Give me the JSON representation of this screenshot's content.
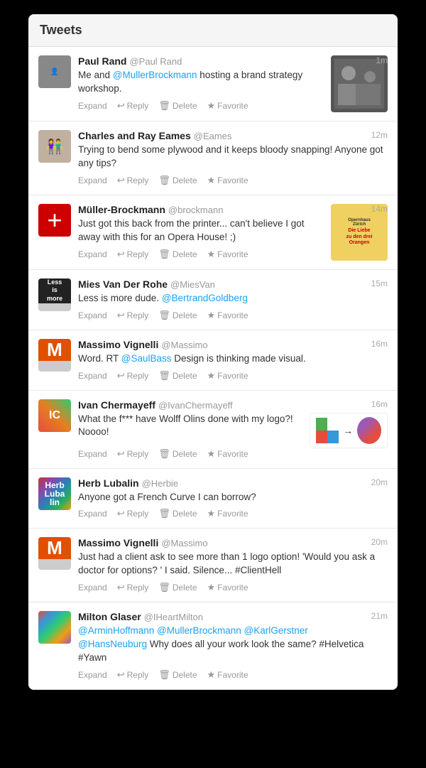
{
  "window": {
    "title": "Tweets"
  },
  "tweets": [
    {
      "id": "tweet-1",
      "name": "Paul Rand",
      "handle": "@Paul Rand",
      "time": "1m",
      "text_parts": [
        {
          "type": "text",
          "content": "Me and "
        },
        {
          "type": "mention",
          "content": "@MullerBrockmann"
        },
        {
          "type": "text",
          "content": " hosting a brand strategy workshop."
        }
      ],
      "text_plain": "Me and @MullerBrockmann hosting a brand strategy workshop.",
      "has_image": true,
      "image_type": "paul-photo",
      "avatar_type": "paul",
      "actions": [
        "Expand",
        "Reply",
        "Delete",
        "Favorite"
      ]
    },
    {
      "id": "tweet-2",
      "name": "Charles and Ray Eames",
      "handle": "@Eames",
      "time": "12m",
      "text_plain": "Trying to bend some plywood and it keeps bloody snapping! Anyone got any tips?",
      "has_image": false,
      "avatar_type": "eames",
      "actions": [
        "Expand",
        "Reply",
        "Delete",
        "Favorite"
      ]
    },
    {
      "id": "tweet-3",
      "name": "Müller-Brockmann",
      "handle": "@brockmann",
      "time": "14m",
      "text_plain": "Just got this back from the printer... can't believe I got away with this for an Opera House! ;)",
      "has_image": true,
      "image_type": "opernhaus",
      "avatar_type": "muller",
      "actions": [
        "Expand",
        "Reply",
        "Delete",
        "Favorite"
      ]
    },
    {
      "id": "tweet-4",
      "name": "Mies Van Der Rohe",
      "handle": "@MiesVan",
      "time": "15m",
      "text_parts": [
        {
          "type": "text",
          "content": "Less is more dude. "
        },
        {
          "type": "mention",
          "content": "@BertrandGoldberg"
        }
      ],
      "text_plain": "Less is more dude. @BertrandGoldberg",
      "has_image": false,
      "avatar_type": "mies",
      "actions": [
        "Expand",
        "Reply",
        "Delete",
        "Favorite"
      ]
    },
    {
      "id": "tweet-5",
      "name": "Massimo Vignelli",
      "handle": "@Massimo",
      "time": "16m",
      "text_parts": [
        {
          "type": "text",
          "content": "Word. RT "
        },
        {
          "type": "mention",
          "content": "@SaulBass"
        },
        {
          "type": "text",
          "content": " Design is thinking made visual."
        }
      ],
      "text_plain": "Word. RT @SaulBass Design is thinking made visual.",
      "has_image": false,
      "avatar_type": "massimo",
      "actions": [
        "Expand",
        "Reply",
        "Delete",
        "Favorite"
      ]
    },
    {
      "id": "tweet-6",
      "name": "Ivan Chermayeff",
      "handle": "@IvanChermayeff",
      "time": "16m",
      "text_plain": "What the f*** have Wolff Olins done with my logo?! Noooo!",
      "has_image": true,
      "image_type": "logo-comparison",
      "avatar_type": "ivan",
      "actions": [
        "Expand",
        "Reply",
        "Delete",
        "Favorite"
      ]
    },
    {
      "id": "tweet-7",
      "name": "Herb Lubalin",
      "handle": "@Herbie",
      "time": "20m",
      "text_plain": "Anyone got a French Curve I can borrow?",
      "has_image": false,
      "avatar_type": "herb",
      "actions": [
        "Expand",
        "Reply",
        "Delete",
        "Favorite"
      ]
    },
    {
      "id": "tweet-8",
      "name": "Massimo Vignelli",
      "handle": "@Massimo",
      "time": "20m",
      "text_plain": "Just had a client ask to see more than 1 logo option! 'Would you ask a doctor for options? ' I said. Silence... #ClientHell",
      "has_image": false,
      "avatar_type": "massimo",
      "actions": [
        "Expand",
        "Reply",
        "Delete",
        "Favorite"
      ]
    },
    {
      "id": "tweet-9",
      "name": "Milton Glaser",
      "handle": "@IHeartMilton",
      "time": "21m",
      "text_parts": [
        {
          "type": "mention",
          "content": "@ArminHoffmann"
        },
        {
          "type": "text",
          "content": " "
        },
        {
          "type": "mention",
          "content": "@MullerBrockmann"
        },
        {
          "type": "text",
          "content": " "
        },
        {
          "type": "mention",
          "content": "@KarlGerstner"
        },
        {
          "type": "text",
          "content": "\n"
        },
        {
          "type": "mention",
          "content": "@HansNeuburg"
        },
        {
          "type": "text",
          "content": " Why does all your work look the same? #Helvetica #Yawn"
        }
      ],
      "text_plain": "@ArminHoffmann @MullerBrockmann @KarlGerstner\n@HansNeuburg Why does all your work look the same? #Helvetica #Yawn",
      "has_image": false,
      "avatar_type": "milton",
      "actions": [
        "Expand",
        "Reply",
        "Delete",
        "Favorite"
      ]
    }
  ],
  "actions": {
    "expand": "Expand",
    "reply": "Reply",
    "delete": "Delete",
    "favorite": "Favorite"
  }
}
